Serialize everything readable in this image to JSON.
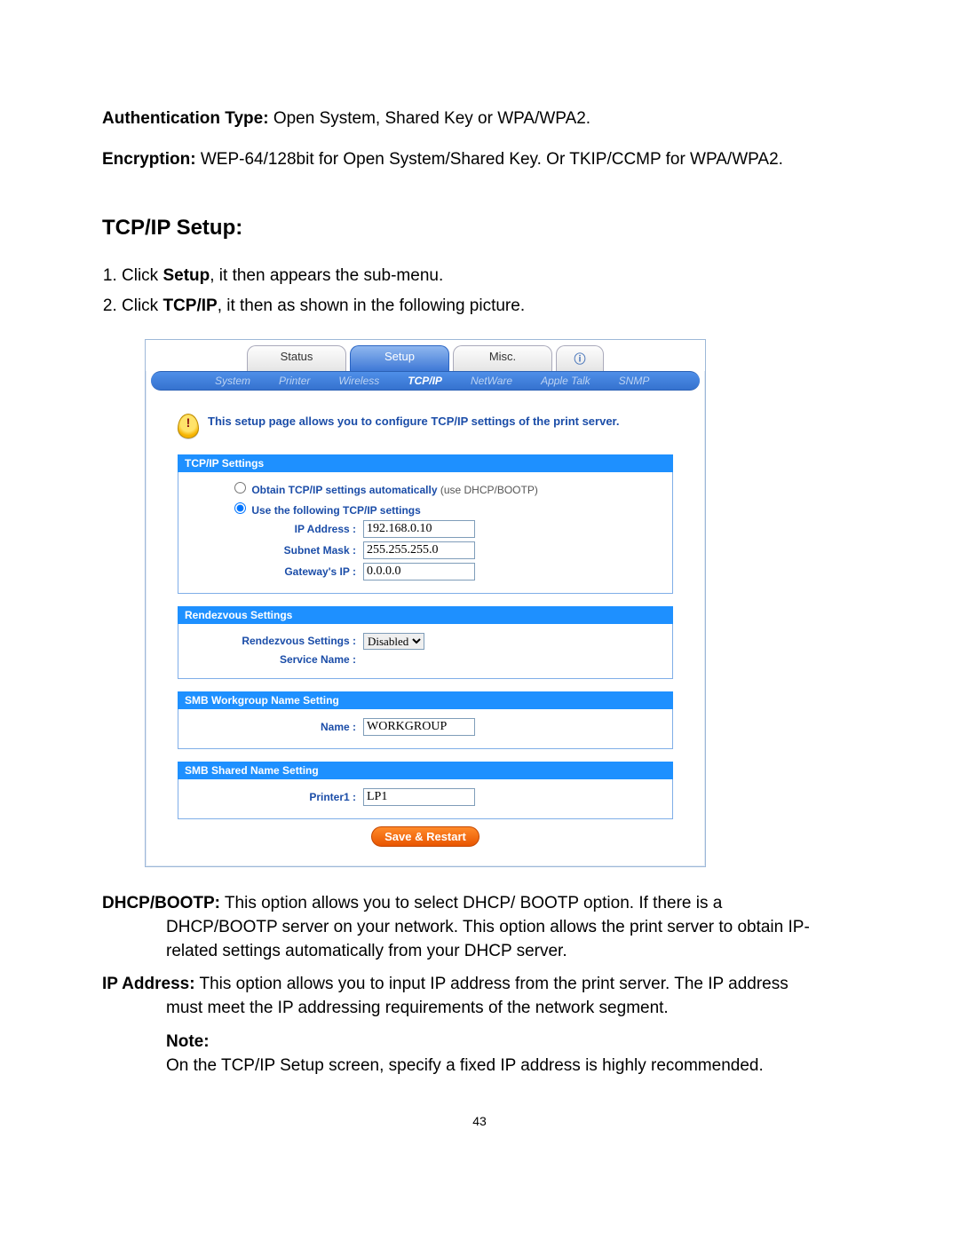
{
  "preamble": {
    "auth_label": "Authentication Type:",
    "auth_text": " Open System, Shared Key or WPA/WPA2.",
    "enc_label": "Encryption:",
    "enc_text": " WEP-64/128bit for Open System/Shared Key. Or TKIP/CCMP for WPA/WPA2."
  },
  "section_title": "TCP/IP Setup:",
  "steps": {
    "s1_a": "Click ",
    "s1_b": "Setup",
    "s1_c": ", it then appears the sub-menu.",
    "s2_a": "Click ",
    "s2_b": "TCP/IP",
    "s2_c": ", it then as shown in the following picture."
  },
  "ui": {
    "main_tabs": {
      "status": "Status",
      "setup": "Setup",
      "misc": "Misc.",
      "info": "ⓘ"
    },
    "sub_tabs": {
      "system": "System",
      "printer": "Printer",
      "wireless": "Wireless",
      "tcpip": "TCP/IP",
      "netware": "NetWare",
      "appletalk": "Apple Talk",
      "snmp": "SNMP"
    },
    "intro": "This setup page allows you to configure TCP/IP settings of the print server.",
    "tcpip": {
      "header": "TCP/IP Settings",
      "opt_auto": "Obtain TCP/IP settings automatically",
      "opt_auto_hint": " (use DHCP/BOOTP)",
      "opt_manual": "Use the following TCP/IP settings",
      "ip_label": "IP Address :",
      "ip_value": "192.168.0.10",
      "mask_label": "Subnet Mask :",
      "mask_value": "255.255.255.0",
      "gw_label": "Gateway's IP :",
      "gw_value": "0.0.0.0"
    },
    "rendezvous": {
      "header": "Rendezvous Settings",
      "label": "Rendezvous Settings :",
      "value": "Disabled",
      "svc_label": "Service Name :",
      "svc_value": ""
    },
    "smb_wg": {
      "header": "SMB Workgroup Name Setting",
      "label": "Name :",
      "value": "WORKGROUP"
    },
    "smb_share": {
      "header": "SMB Shared Name Setting",
      "label": "Printer1 :",
      "value": "LP1"
    },
    "save_btn": "Save & Restart"
  },
  "descriptions": {
    "dhcp_label": "DHCP/BOOTP:",
    "dhcp_text1": " This option allows you to select DHCP/ BOOTP option. If there is a",
    "dhcp_text2": "DHCP/BOOTP server on your network. This option allows the print server to obtain IP-related settings automatically from your DHCP server.",
    "ip_label": "IP Address:",
    "ip_text1": " This option allows you to input IP address from the print server. The IP address",
    "ip_text2": "must meet the IP addressing requirements of the network segment.",
    "note_label": "Note:",
    "note_text": "On the TCP/IP Setup screen, specify a fixed IP address is highly recommended."
  },
  "page_number": "43"
}
